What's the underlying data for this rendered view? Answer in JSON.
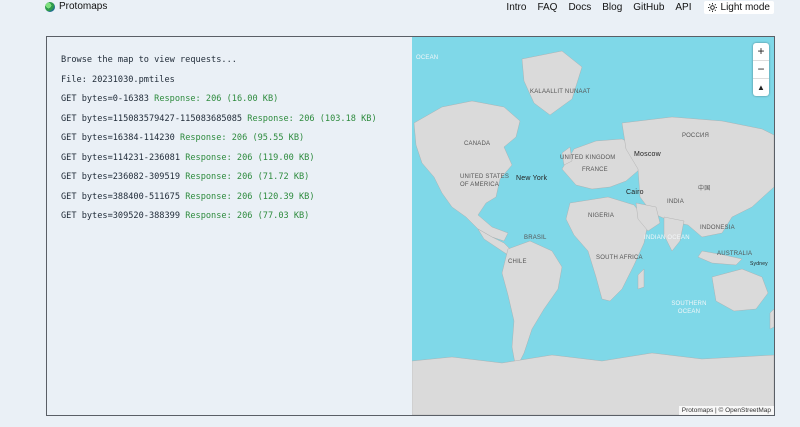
{
  "brand": {
    "name": "Protomaps"
  },
  "nav": {
    "items": [
      "Intro",
      "FAQ",
      "Docs",
      "Blog",
      "GitHub",
      "API"
    ],
    "mode_label": "Light mode"
  },
  "log": {
    "lines": [
      {
        "text": "Browse the map to view requests...",
        "resp": ""
      },
      {
        "text": "File: 20231030.pmtiles",
        "resp": ""
      },
      {
        "text": "GET bytes=0-16383",
        "resp": "Response: 206 (16.00 KB)"
      },
      {
        "text": "GET bytes=115083579427-115083685085",
        "resp": "Response: 206 (103.18 KB)"
      },
      {
        "text": "GET bytes=16384-114230",
        "resp": "Response: 206 (95.55 KB)"
      },
      {
        "text": "GET bytes=114231-236081",
        "resp": "Response: 206 (119.00 KB)"
      },
      {
        "text": "GET bytes=236082-309519",
        "resp": "Response: 206 (71.72 KB)"
      },
      {
        "text": "GET bytes=388400-511675",
        "resp": "Response: 206 (120.39 KB)"
      },
      {
        "text": "GET bytes=309520-388399",
        "resp": "Response: 206 (77.03 KB)"
      }
    ]
  },
  "map": {
    "labels": {
      "ocean_top": "OCEAN",
      "kalaallit": "KALAALLIT NUNAAT",
      "canada": "CANADA",
      "usa": "UNITED STATES OF AMERICA",
      "new_york": "New York",
      "uk": "UNITED KINGDOM",
      "france": "FRANCE",
      "moscow": "Moscow",
      "russia": "РОССИЯ",
      "china": "中国",
      "india": "INDIA",
      "cairo": "Cairo",
      "nigeria": "NIGERIA",
      "brasil": "BRASIL",
      "chile": "CHILE",
      "south_africa": "SOUTH AFRICA",
      "indian_ocean": "INDIAN OCEAN",
      "indonesia": "INDONESIA",
      "australia": "AUSTRALIA",
      "sydney": "Sydney",
      "southern_ocean": "SOUTHERN OCEAN"
    },
    "zoom_in": "+",
    "zoom_out": "−",
    "compass": "▲",
    "attribution": "Protomaps | © OpenStreetMap"
  },
  "colors": {
    "ocean": "#7fd8e8",
    "land": "#dadada",
    "response": "#2e8b3e",
    "page_bg": "#eaf0f6"
  }
}
